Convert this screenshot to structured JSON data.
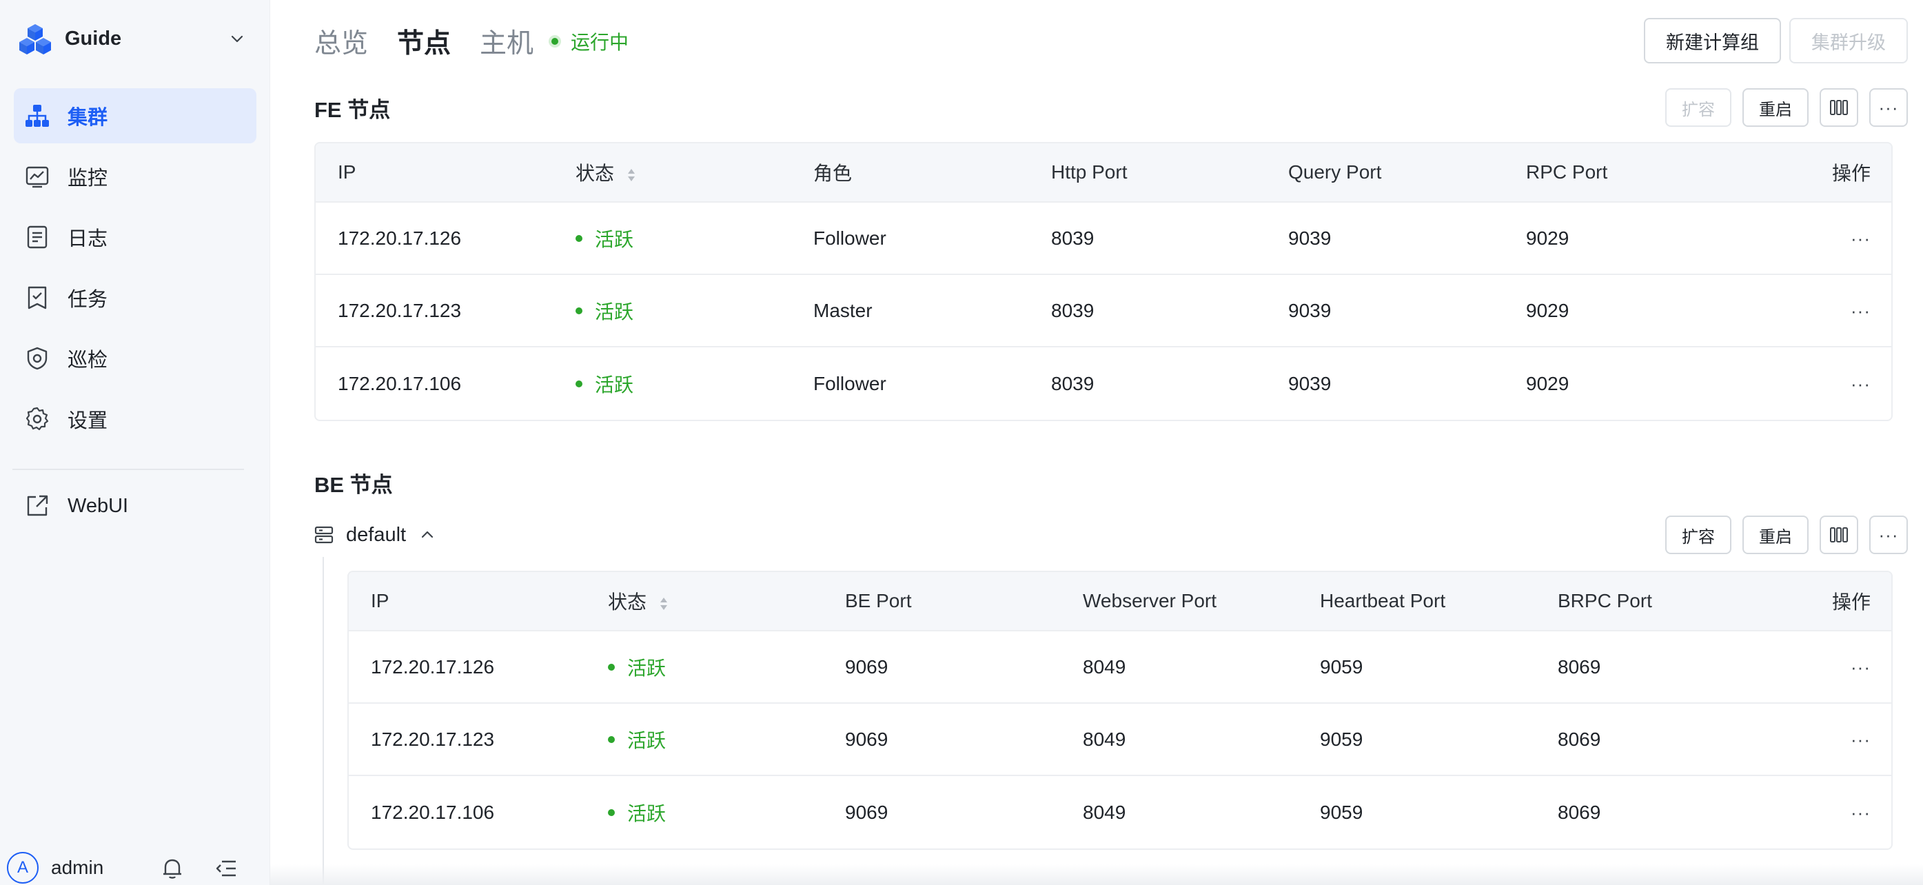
{
  "sidebar": {
    "app_name": "Guide",
    "items": [
      {
        "label": "集群",
        "icon": "cluster-icon",
        "active": true
      },
      {
        "label": "监控",
        "icon": "monitor-icon",
        "active": false
      },
      {
        "label": "日志",
        "icon": "log-icon",
        "active": false
      },
      {
        "label": "任务",
        "icon": "task-icon",
        "active": false
      },
      {
        "label": "巡检",
        "icon": "inspect-icon",
        "active": false
      },
      {
        "label": "设置",
        "icon": "gear-icon",
        "active": false
      }
    ],
    "webui": {
      "label": "WebUI",
      "icon": "external-link-icon"
    },
    "user": {
      "avatar": "A",
      "name": "admin"
    }
  },
  "header": {
    "tabs": [
      {
        "label": "总览",
        "active": false
      },
      {
        "label": "节点",
        "active": true
      },
      {
        "label": "主机",
        "active": false
      }
    ],
    "status": "运行中",
    "new_group_label": "新建计算组",
    "upgrade_label": "集群升级"
  },
  "fe": {
    "title": "FE 节点",
    "actions": {
      "scale": "扩容",
      "restart": "重启"
    },
    "columns": [
      "IP",
      "状态",
      "角色",
      "Http Port",
      "Query Port",
      "RPC Port",
      "操作"
    ],
    "rows": [
      {
        "ip": "172.20.17.126",
        "status": "活跃",
        "role": "Follower",
        "http": "8039",
        "query": "9039",
        "rpc": "9029",
        "ops": "···"
      },
      {
        "ip": "172.20.17.123",
        "status": "活跃",
        "role": "Master",
        "http": "8039",
        "query": "9039",
        "rpc": "9029",
        "ops": "···"
      },
      {
        "ip": "172.20.17.106",
        "status": "活跃",
        "role": "Follower",
        "http": "8039",
        "query": "9039",
        "rpc": "9029",
        "ops": "···"
      }
    ]
  },
  "be": {
    "title": "BE 节点",
    "group": "default",
    "actions": {
      "scale": "扩容",
      "restart": "重启"
    },
    "columns": [
      "IP",
      "状态",
      "BE Port",
      "Webserver Port",
      "Heartbeat Port",
      "BRPC Port",
      "操作"
    ],
    "rows": [
      {
        "ip": "172.20.17.126",
        "status": "活跃",
        "be": "9069",
        "web": "8049",
        "hb": "9059",
        "brpc": "8069",
        "ops": "···"
      },
      {
        "ip": "172.20.17.123",
        "status": "活跃",
        "be": "9069",
        "web": "8049",
        "hb": "9059",
        "brpc": "8069",
        "ops": "···"
      },
      {
        "ip": "172.20.17.106",
        "status": "活跃",
        "be": "9069",
        "web": "8049",
        "hb": "9059",
        "brpc": "8069",
        "ops": "···"
      }
    ]
  },
  "more_label": "···",
  "colors": {
    "accent": "#1e5ff5",
    "success": "#2ca62c",
    "sidebar_bg": "#f5f7fa"
  }
}
